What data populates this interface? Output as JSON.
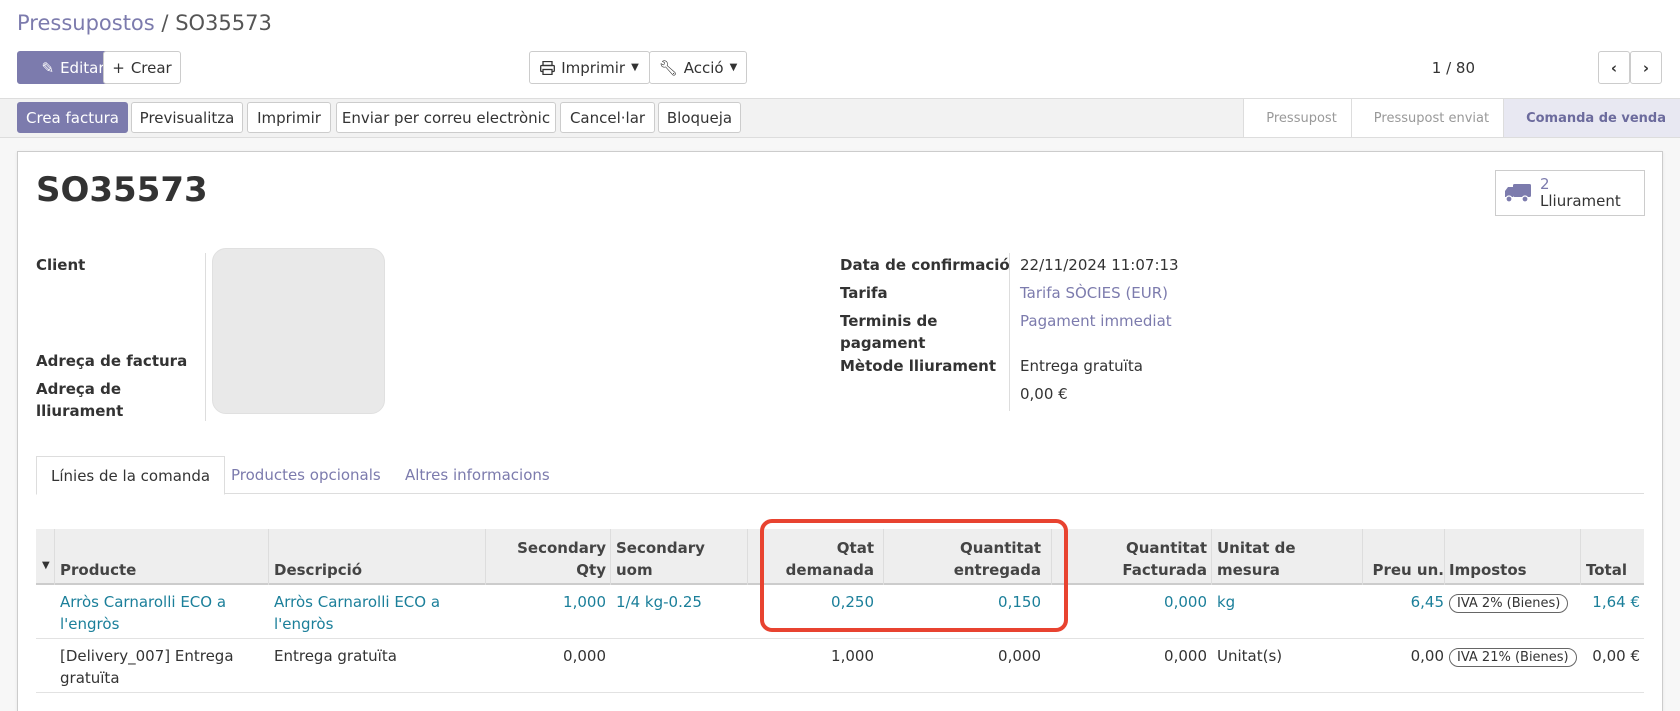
{
  "breadcrumb": {
    "parent": "Pressupostos",
    "separator": "/",
    "current": "SO35573"
  },
  "toolbar": {
    "edit_label": "Editar",
    "create_label": "Crear",
    "print_label": "Imprimir",
    "action_label": "Acció"
  },
  "pager": {
    "value": "1 / 80"
  },
  "statusbar": {
    "buttons": [
      "Crea factura",
      "Previsualitza",
      "Imprimir",
      "Enviar per correu electrònic",
      "Cancel·lar",
      "Bloqueja"
    ],
    "stages": [
      "Pressupost",
      "Pressupost enviat",
      "Comanda de venda"
    ],
    "active_stage": "Comanda de venda"
  },
  "record": {
    "title": "SO35573",
    "smart_button": {
      "count": "2",
      "label": "Lliurament",
      "icon": "truck-icon"
    }
  },
  "left_fields": {
    "client_label": "Client",
    "invoice_address_label": "Adreça de factura",
    "delivery_address_label": "Adreça de lliurament"
  },
  "right_fields": {
    "confirmation_date_label": "Data de confirmació",
    "confirmation_date": "22/11/2024 11:07:13",
    "pricelist_label": "Tarifa",
    "pricelist": "Tarifa SÒCIES (EUR)",
    "payment_terms_label": "Terminis de pagament",
    "payment_terms": "Pagament immediat",
    "delivery_method_label": "Mètode lliurament",
    "delivery_method": "Entrega gratuïta",
    "delivery_amount": "0,00 €"
  },
  "tabs": [
    "Línies de la comanda",
    "Productes opcionals",
    "Altres informacions"
  ],
  "table": {
    "columns": {
      "product": "Producte",
      "description": "Descripció",
      "secondary_qty": "Secondary Qty",
      "secondary_uom": "Secondary uom",
      "qty_ordered": "Qtat demanada",
      "qty_delivered": "Quantitat entregada",
      "qty_invoiced": "Quantitat Facturada",
      "uom": "Unitat de mesura",
      "unit_price": "Preu un.",
      "taxes": "Impostos",
      "total": "Total"
    },
    "rows": [
      {
        "product": "Arròs Carnarolli ECO a l'engròs",
        "description": "Arròs Carnarolli ECO  a l'engròs",
        "secondary_qty": "1,000",
        "secondary_uom": "1/4 kg-0.25",
        "qty_ordered": "0,250",
        "qty_delivered": "0,150",
        "qty_invoiced": "0,000",
        "uom": "kg",
        "unit_price": "6,45",
        "taxes": "IVA 2% (Bienes)",
        "total": "1,64 €"
      },
      {
        "product": "[Delivery_007] Entrega gratuïta",
        "description": "Entrega gratuïta",
        "secondary_qty": "0,000",
        "secondary_uom": "",
        "qty_ordered": "1,000",
        "qty_delivered": "0,000",
        "qty_invoiced": "0,000",
        "uom": "Unitat(s)",
        "unit_price": "0,00",
        "taxes": "IVA 21% (Bienes)",
        "total": "0,00 €"
      }
    ]
  },
  "colors": {
    "brand": "#7c7bad",
    "link": "#1b7f9a",
    "highlight": "#e84330"
  }
}
